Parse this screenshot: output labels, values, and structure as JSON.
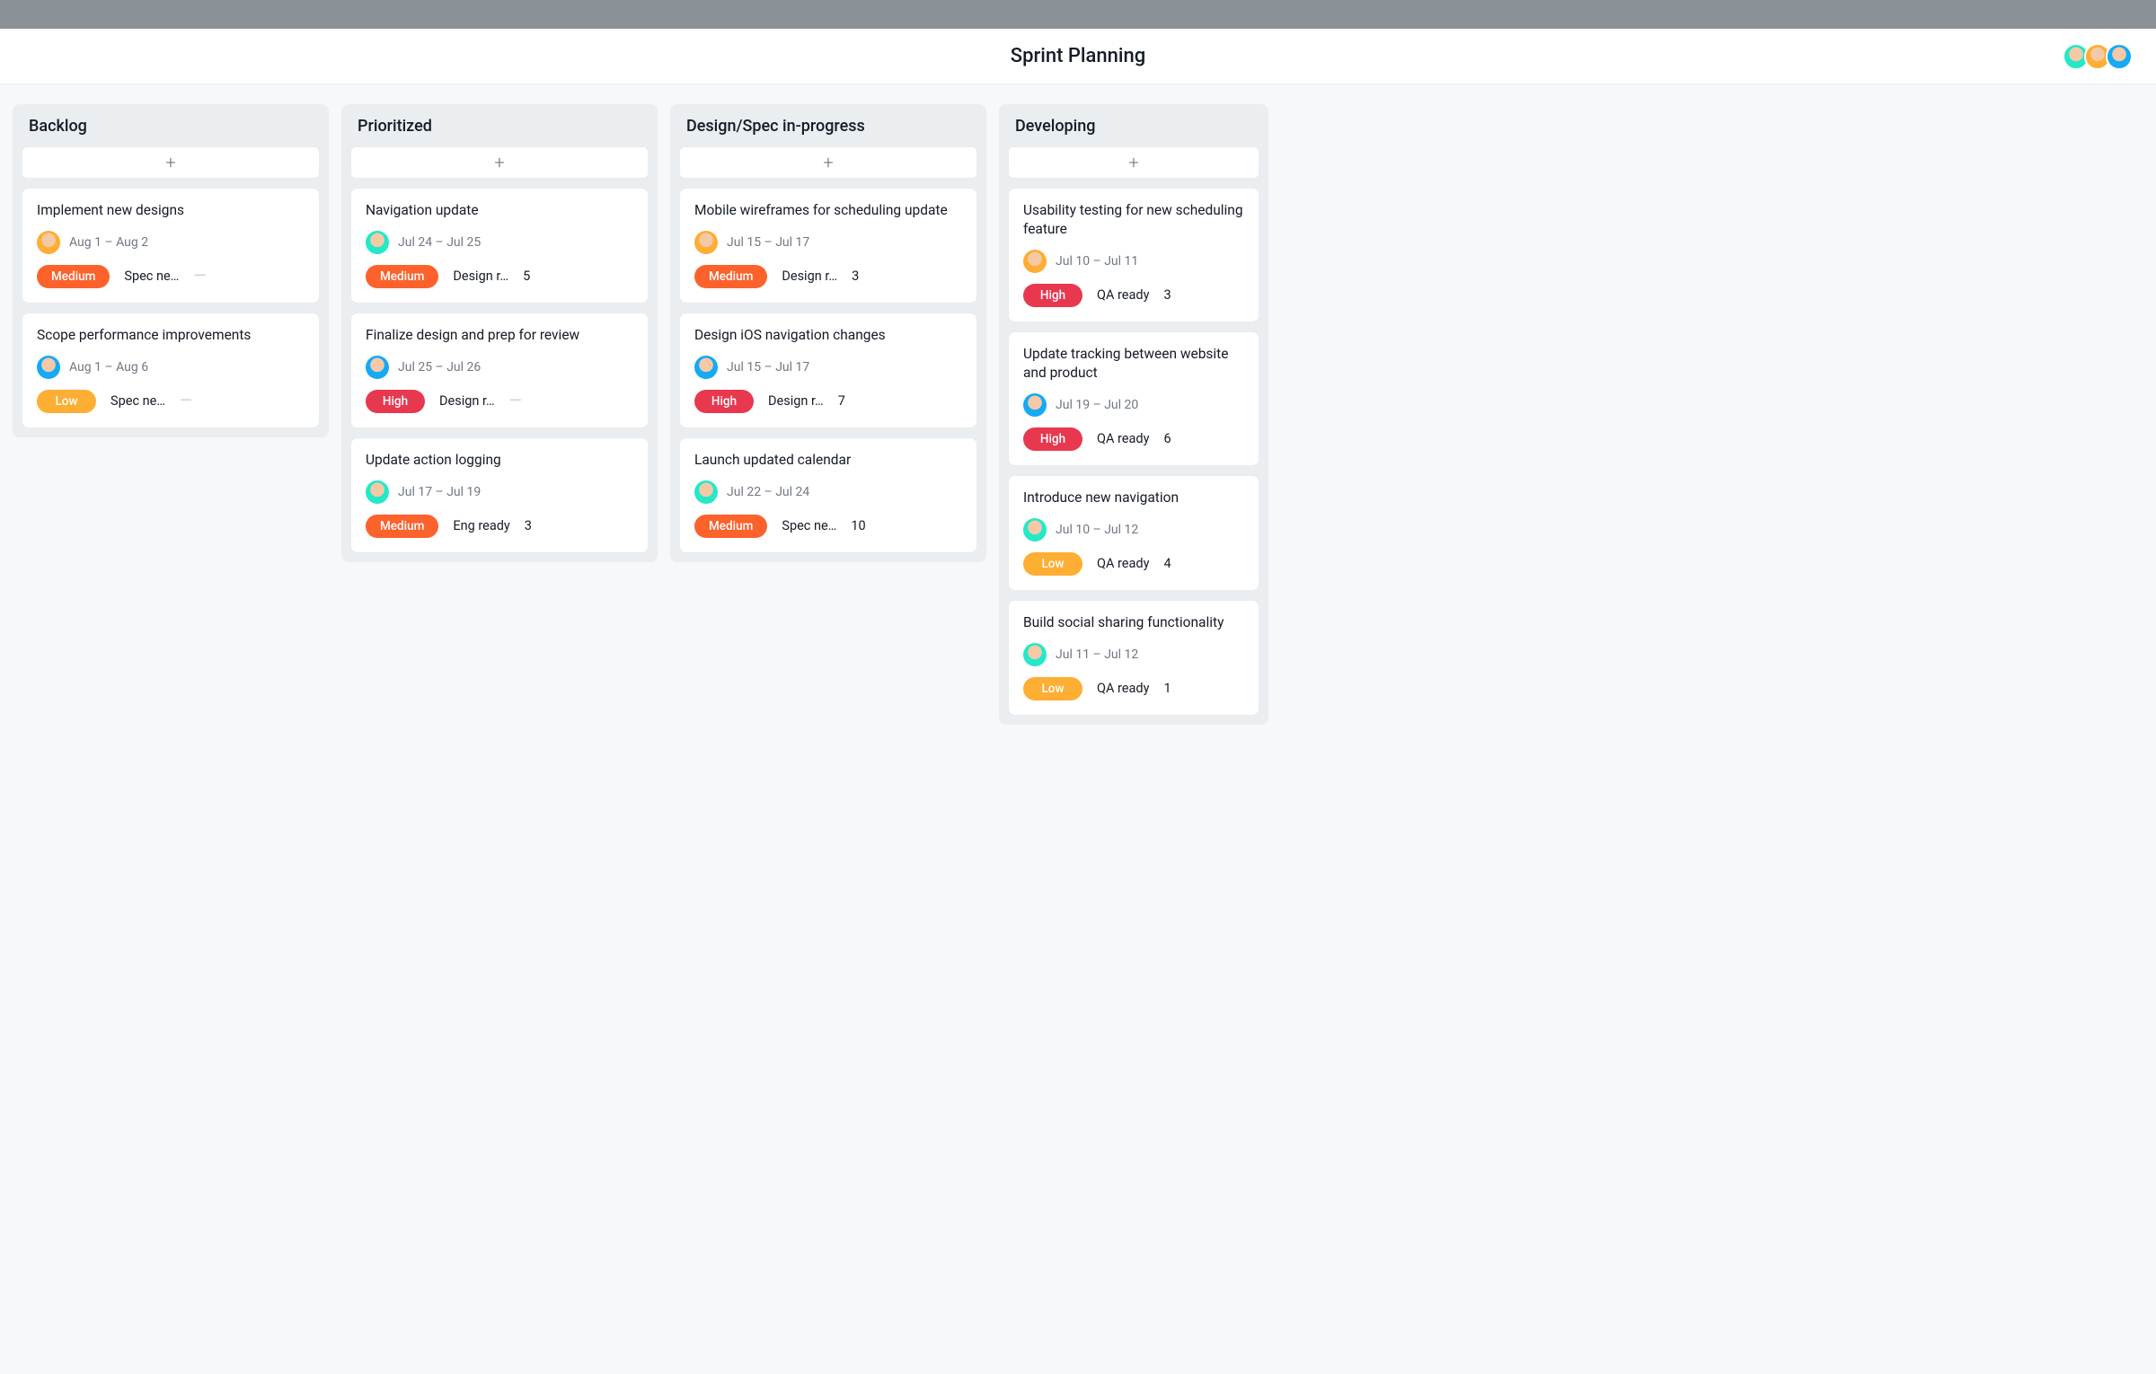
{
  "header": {
    "title": "Sprint Planning",
    "avatars": [
      "green",
      "orange",
      "cyan"
    ]
  },
  "priority_labels": {
    "medium": "Medium",
    "high": "High",
    "low": "Low"
  },
  "columns": [
    {
      "title": "Backlog",
      "cards": [
        {
          "title": "Implement new designs",
          "avatar": "orange",
          "date": "Aug 1 – Aug 2",
          "priority": "medium",
          "status": "Spec ne…",
          "count": "—"
        },
        {
          "title": "Scope performance improvements",
          "avatar": "cyan",
          "date": "Aug 1 – Aug 6",
          "priority": "low",
          "status": "Spec ne…",
          "count": "—"
        }
      ]
    },
    {
      "title": "Prioritized",
      "cards": [
        {
          "title": "Navigation update",
          "avatar": "green",
          "date": "Jul 24 – Jul 25",
          "priority": "medium",
          "status": "Design r…",
          "count": "5"
        },
        {
          "title": "Finalize design and prep for review",
          "avatar": "cyan",
          "date": "Jul 25 – Jul 26",
          "priority": "high",
          "status": "Design r…",
          "count": "—"
        },
        {
          "title": "Update action logging",
          "avatar": "green",
          "date": "Jul 17 – Jul 19",
          "priority": "medium",
          "status": "Eng ready",
          "count": "3"
        }
      ]
    },
    {
      "title": "Design/Spec in-progress",
      "cards": [
        {
          "title": "Mobile wireframes for scheduling update",
          "avatar": "orange",
          "date": "Jul 15 – Jul 17",
          "priority": "medium",
          "status": "Design r…",
          "count": "3"
        },
        {
          "title": "Design iOS navigation changes",
          "avatar": "cyan",
          "date": "Jul 15 – Jul 17",
          "priority": "high",
          "status": "Design r…",
          "count": "7"
        },
        {
          "title": "Launch updated calendar",
          "avatar": "green",
          "date": "Jul 22 – Jul 24",
          "priority": "medium",
          "status": "Spec ne…",
          "count": "10"
        }
      ]
    },
    {
      "title": "Developing",
      "cards": [
        {
          "title": "Usability testing for new scheduling feature",
          "avatar": "orange",
          "date": "Jul 10 – Jul 11",
          "priority": "high",
          "status": "QA ready",
          "count": "3"
        },
        {
          "title": "Update tracking between website and product",
          "avatar": "cyan",
          "date": "Jul 19 – Jul 20",
          "priority": "high",
          "status": "QA ready",
          "count": "6"
        },
        {
          "title": "Introduce new navigation",
          "avatar": "green",
          "date": "Jul 10 – Jul 12",
          "priority": "low",
          "status": "QA ready",
          "count": "4"
        },
        {
          "title": "Build social sharing functionality",
          "avatar": "green",
          "date": "Jul 11 – Jul 12",
          "priority": "low",
          "status": "QA ready",
          "count": "1"
        }
      ]
    }
  ]
}
